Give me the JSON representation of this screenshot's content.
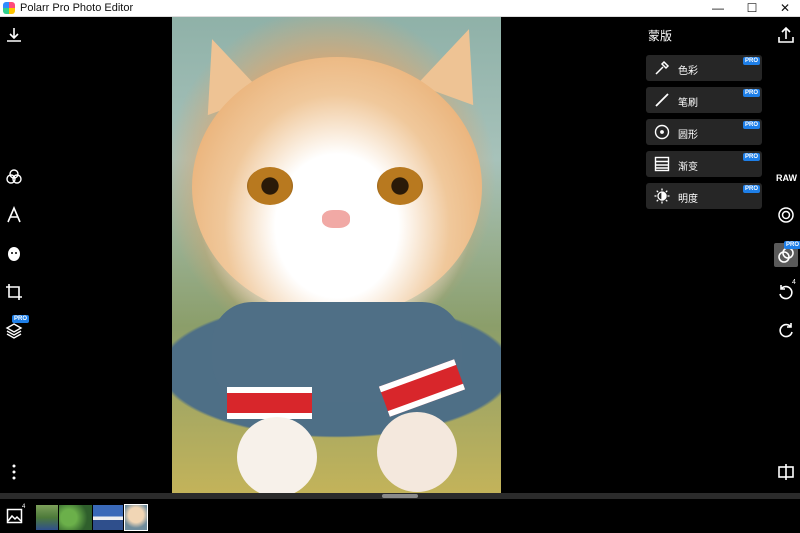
{
  "window": {
    "title": "Polarr Pro Photo Editor",
    "minimize_glyph": "—",
    "maximize_glyph": "☐",
    "close_glyph": "✕"
  },
  "left_toolbar": {
    "items": [
      "download-icon",
      "filters-icon",
      "text-icon",
      "face-icon",
      "crop-icon",
      "layers-icon",
      "more-icon"
    ],
    "pro_label": "PRO"
  },
  "mask_panel": {
    "title": "蒙版",
    "pro_label": "PRO",
    "items": [
      {
        "label": "色彩",
        "icon": "eyedropper-icon"
      },
      {
        "label": "笔刷",
        "icon": "brush-icon"
      },
      {
        "label": "圆形",
        "icon": "radial-icon"
      },
      {
        "label": "渐变",
        "icon": "gradient-icon"
      },
      {
        "label": "明度",
        "icon": "luminance-icon"
      }
    ]
  },
  "right_toolbar": {
    "raw_label": "RAW",
    "pro_label": "PRO",
    "history_count": "4"
  },
  "filmstrip": {
    "gallery_count": "4",
    "thumbnails": [
      "landscape",
      "greenery",
      "sky",
      "cat"
    ]
  },
  "colors": {
    "accent_pro": "#1e7fe8",
    "panel_button": "#262626",
    "background": "#000000"
  }
}
